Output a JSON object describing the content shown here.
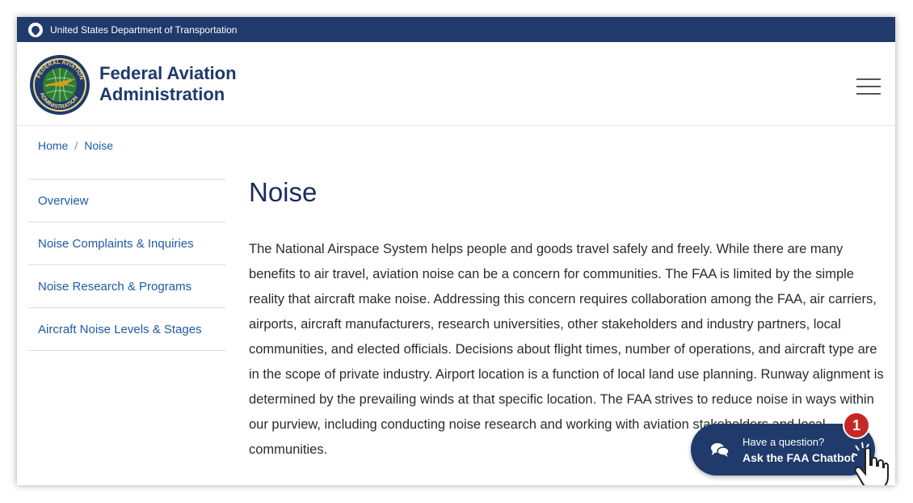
{
  "gov_bar": {
    "text": "United States Department of Transportation"
  },
  "brand": {
    "line1": "Federal Aviation",
    "line2": "Administration",
    "seal_top": "FEDERAL AVIATION",
    "seal_bottom": "ADMINISTRATION"
  },
  "breadcrumb": {
    "home": "Home",
    "separator": "/",
    "current": "Noise"
  },
  "sidenav": {
    "items": [
      {
        "label": "Overview"
      },
      {
        "label": "Noise Complaints & Inquiries"
      },
      {
        "label": "Noise Research & Programs"
      },
      {
        "label": "Aircraft Noise Levels & Stages"
      }
    ]
  },
  "main": {
    "title": "Noise",
    "body": "The National Airspace System helps people and goods travel safely and freely. While there are many benefits to air travel, aviation noise can be a concern for communities. The FAA is limited by the simple reality that aircraft make noise. Addressing this concern requires collaboration among the FAA, air carriers, airports, aircraft manufacturers, research universities, other stakeholders and industry partners, local communities, and elected officials. Decisions about flight times, number of operations, and aircraft type are in the scope of private industry. Airport location is a function of local land use planning. Runway alignment is determined by the prevailing winds at that specific location. The FAA strives to reduce noise in ways within our purview, including conducting noise research and working with aviation stakeholders and local communities."
  },
  "chatbot": {
    "question": "Have a question?",
    "cta": "Ask the FAA Chatbot",
    "badge": "1"
  },
  "icons": {
    "gov": "dot-logo-icon",
    "menu": "hamburger-menu-icon",
    "chat": "chat-bubbles-icon",
    "hand": "pointer-hand-icon"
  },
  "colors": {
    "navy": "#1f3a6b",
    "link": "#1f5aa6",
    "badge": "#c62828"
  }
}
